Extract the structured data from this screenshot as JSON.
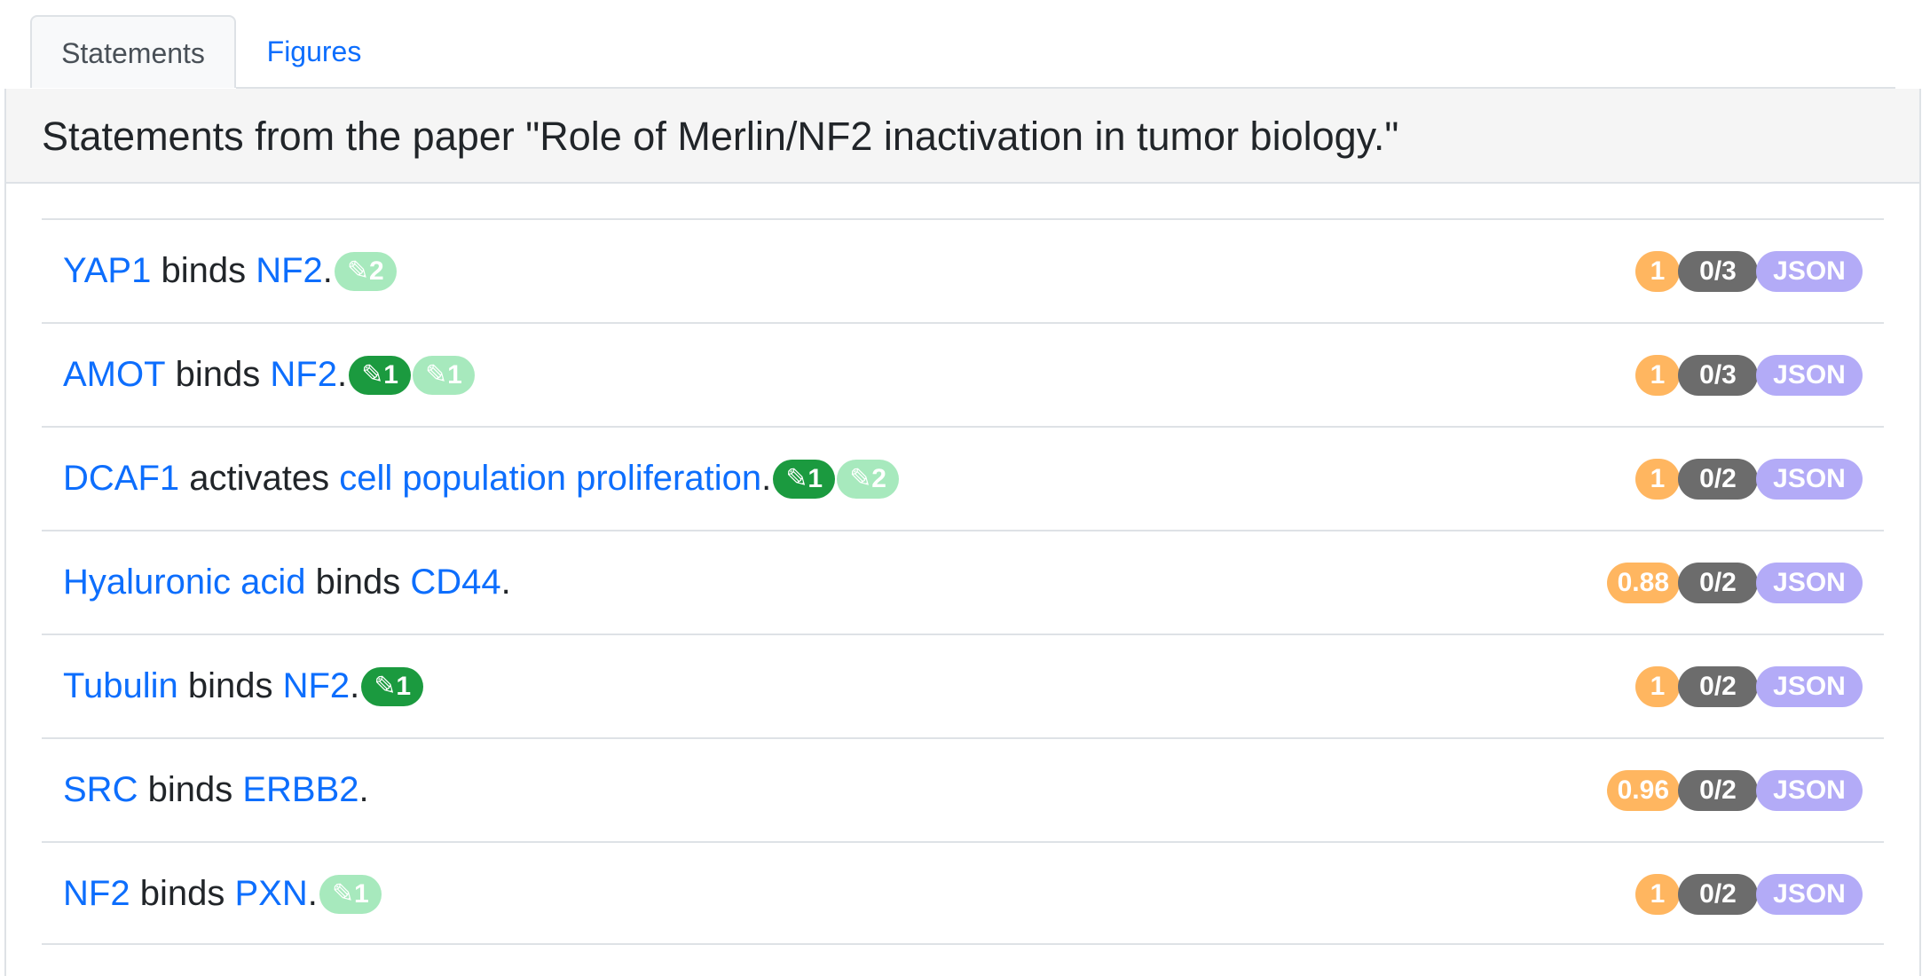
{
  "tabs": [
    {
      "label": "Statements"
    },
    {
      "label": "Figures"
    }
  ],
  "panel": {
    "title": "Statements from the paper \"Role of Merlin/NF2 inactivation in tumor biology.\""
  },
  "statements": [
    {
      "subject": "YAP1",
      "verb": "binds",
      "object": "NF2",
      "end": ".",
      "curations": [
        {
          "style": "light",
          "label": "✎2"
        }
      ],
      "belief": "1",
      "evidence": "0/3",
      "json": "JSON"
    },
    {
      "subject": "AMOT",
      "verb": "binds",
      "object": "NF2",
      "end": ".",
      "curations": [
        {
          "style": "dark",
          "label": "✎1"
        },
        {
          "style": "light",
          "label": "✎1"
        }
      ],
      "belief": "1",
      "evidence": "0/3",
      "json": "JSON"
    },
    {
      "subject": "DCAF1",
      "verb": "activates",
      "object": "cell population proliferation",
      "end": ".",
      "curations": [
        {
          "style": "dark",
          "label": "✎1"
        },
        {
          "style": "light",
          "label": "✎2"
        }
      ],
      "belief": "1",
      "evidence": "0/2",
      "json": "JSON"
    },
    {
      "subject": "Hyaluronic acid",
      "verb": "binds",
      "object": "CD44",
      "end": ".",
      "curations": [],
      "belief": "0.88",
      "evidence": "0/2",
      "json": "JSON"
    },
    {
      "subject": "Tubulin",
      "verb": "binds",
      "object": "NF2",
      "end": ".",
      "curations": [
        {
          "style": "dark",
          "label": "✎1"
        }
      ],
      "belief": "1",
      "evidence": "0/2",
      "json": "JSON"
    },
    {
      "subject": "SRC",
      "verb": "binds",
      "object": "ERBB2",
      "end": ".",
      "curations": [],
      "belief": "0.96",
      "evidence": "0/2",
      "json": "JSON"
    },
    {
      "subject": "NF2",
      "verb": "binds",
      "object": "PXN",
      "end": ".",
      "curations": [
        {
          "style": "light",
          "label": "✎1"
        }
      ],
      "belief": "1",
      "evidence": "0/2",
      "json": "JSON"
    }
  ],
  "colors": {
    "link": "#0d6efd",
    "belief_badge": "#ffb660",
    "evidence_badge": "#6c6c6c",
    "json_badge": "#b3abf7",
    "curation_dark": "#1b9a3f",
    "curation_light": "#a7e9bd"
  }
}
